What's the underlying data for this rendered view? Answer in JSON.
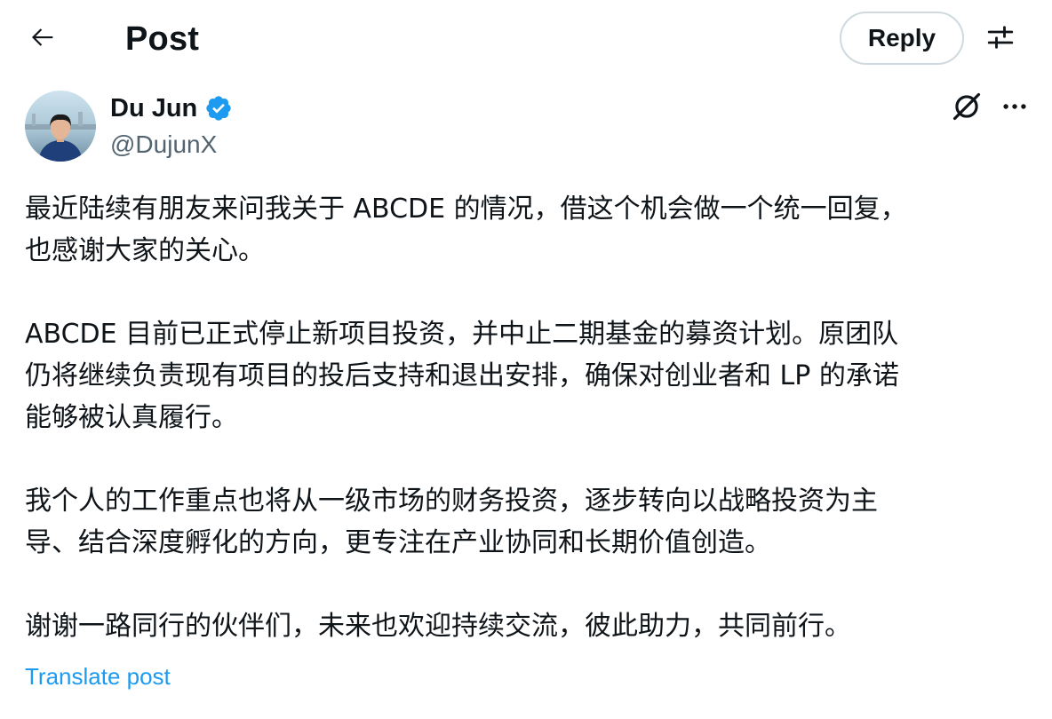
{
  "header": {
    "back_icon": "arrow-left-icon",
    "title": "Post",
    "reply_label": "Reply",
    "settings_icon": "sliders-icon"
  },
  "author": {
    "name": "Du Jun",
    "handle": "@DujunX",
    "verified": true,
    "verified_color": "#1d9bf0",
    "avatar_icon": "profile-photo"
  },
  "actions": {
    "grok_icon": "grok-icon",
    "more_icon": "more-dots-icon"
  },
  "post": {
    "paragraphs": [
      {
        "lines": [
          "最近陆续有朋友来问我关于 ABCDE 的情况，借这个机会做一个统一回复，",
          "也感谢大家的关心。"
        ]
      },
      {
        "lines": [
          "ABCDE 目前已正式停止新项目投资，并中止二期基金的募资计划。原团队",
          "仍将继续负责现有项目的投后支持和退出安排，确保对创业者和 LP 的承诺",
          "能够被认真履行。"
        ]
      },
      {
        "lines": [
          "我个人的工作重点也将从一级市场的财务投资，逐步转向以战略投资为主",
          "导、结合深度孵化的方向，更专注在产业协同和长期价值创造。"
        ]
      },
      {
        "lines": [
          "谢谢一路同行的伙伴们，未来也欢迎持续交流，彼此助力，共同前行。"
        ]
      }
    ],
    "translate_label": "Translate post"
  },
  "colors": {
    "text_primary": "#0f1419",
    "text_secondary": "#536471",
    "link": "#1d9bf0",
    "border": "#cfd9de"
  }
}
